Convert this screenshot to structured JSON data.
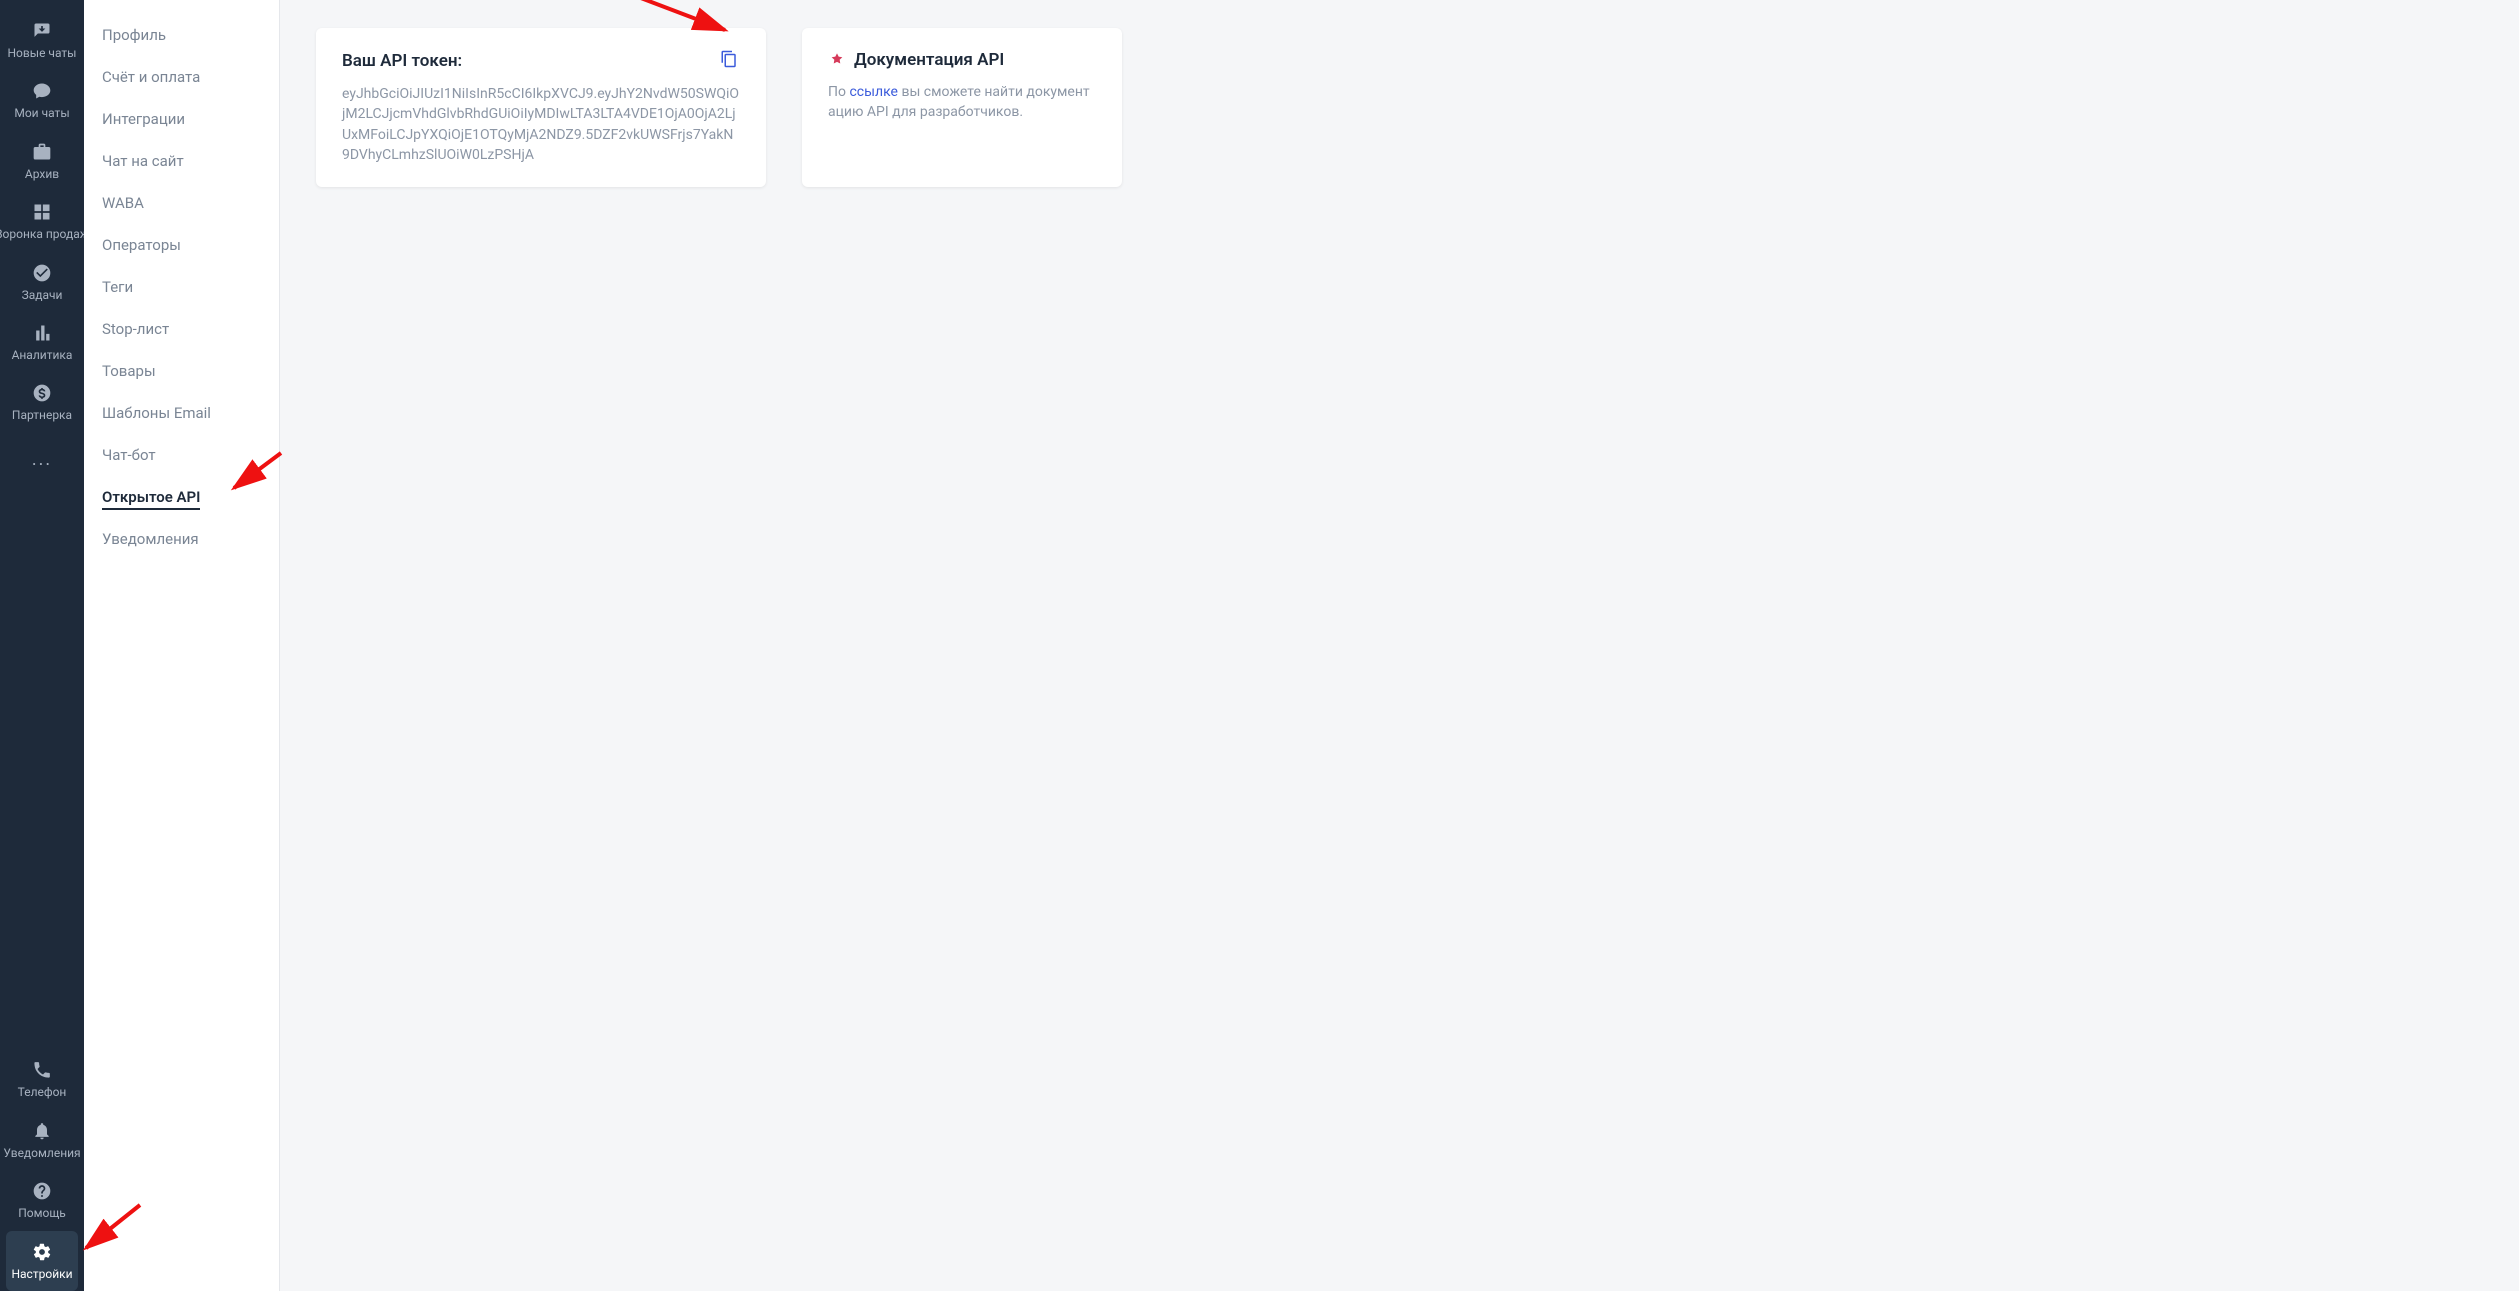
{
  "leftbar": {
    "top": [
      {
        "label": "Новые чаты",
        "icon": "inbox"
      },
      {
        "label": "Мои чаты",
        "icon": "chat"
      },
      {
        "label": "Архив",
        "icon": "briefcase"
      },
      {
        "label": "Воронка продаж",
        "icon": "grid"
      },
      {
        "label": "Задачи",
        "icon": "check"
      },
      {
        "label": "Аналитика",
        "icon": "bars"
      },
      {
        "label": "Партнерка",
        "icon": "dollar"
      }
    ],
    "ellipsis": "...",
    "bottom": [
      {
        "label": "Телефон",
        "icon": "phone"
      },
      {
        "label": "Уведомления",
        "icon": "bell"
      },
      {
        "label": "Помощь",
        "icon": "question"
      },
      {
        "label": "Настройки",
        "icon": "gear",
        "active": true
      }
    ]
  },
  "subnav": {
    "items": [
      {
        "label": "Профиль"
      },
      {
        "label": "Счёт и оплата"
      },
      {
        "label": "Интеграции"
      },
      {
        "label": "Чат на сайт"
      },
      {
        "label": "WABA"
      },
      {
        "label": "Операторы"
      },
      {
        "label": "Теги"
      },
      {
        "label": "Stop-лист"
      },
      {
        "label": "Товары"
      },
      {
        "label": "Шаблоны Email"
      },
      {
        "label": "Чат-бот"
      },
      {
        "label": "Открытое API",
        "active": true
      },
      {
        "label": "Уведомления"
      }
    ]
  },
  "cards": {
    "token": {
      "title": "Ваш API токен:",
      "value": "eyJhbGciOiJIUzI1NiIsInR5cCI6IkpXVCJ9.eyJhY2NvdW50SWQiOjM2LCJjcmVhdGlvbRhdGUiOiIyMDIwLTA3LTA4VDE1OjA0OjA2LjUxMFoiLCJpYXQiOjE1OTQyMjA2NDZ9.5DZF2vkUWSFrjs7YakN9DVhyCLmhzSlUOiW0LzPSHjA"
    },
    "docs": {
      "title": "Документация API",
      "text_before": "По ",
      "link": "ссылке",
      "text_after": " вы сможете найти документацию API для разработчиков."
    }
  }
}
